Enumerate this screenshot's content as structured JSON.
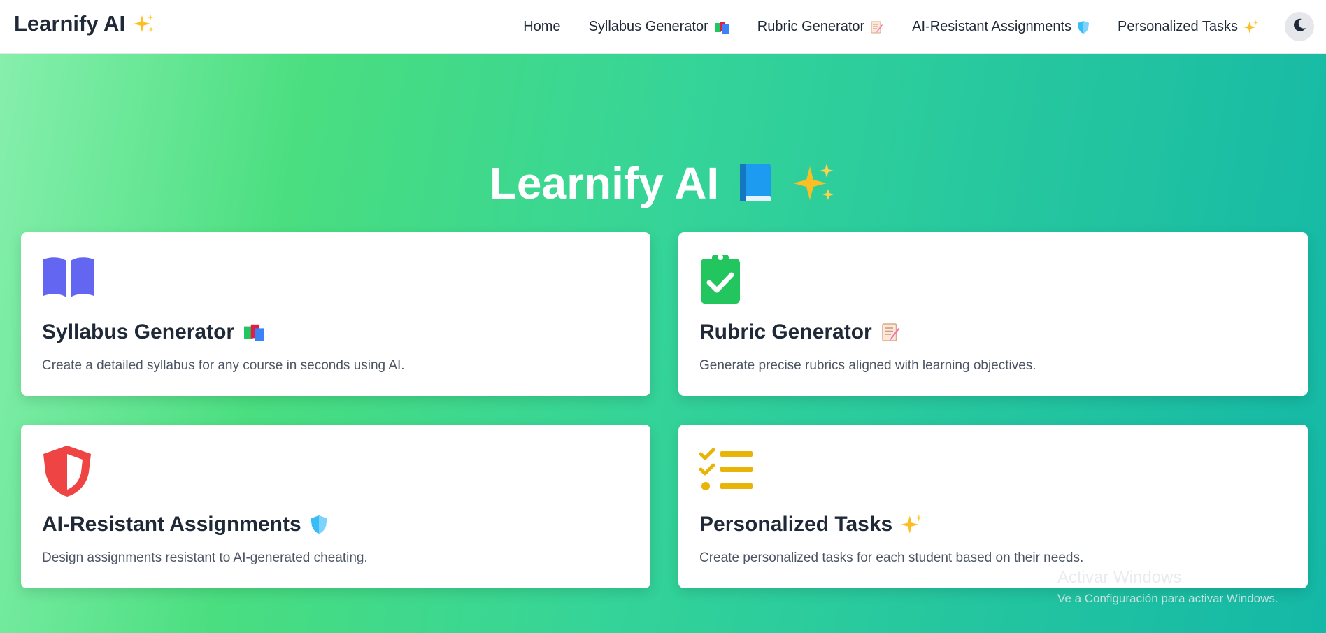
{
  "navbar": {
    "brand": "Learnify AI",
    "links": [
      {
        "label": "Home"
      },
      {
        "label": "Syllabus Generator"
      },
      {
        "label": "Rubric Generator"
      },
      {
        "label": "AI-Resistant Assignments"
      },
      {
        "label": "Personalized Tasks"
      }
    ],
    "theme_toggle_icon": "moon-icon"
  },
  "hero": {
    "title": "Learnify AI"
  },
  "cards": [
    {
      "title": "Syllabus Generator",
      "description": "Create a detailed syllabus for any course in seconds using AI.",
      "icon": "book-open-icon",
      "color": "#6366f1"
    },
    {
      "title": "Rubric Generator",
      "description": "Generate precise rubrics aligned with learning objectives.",
      "icon": "clipboard-check-icon",
      "color": "#22c55e"
    },
    {
      "title": "AI-Resistant Assignments",
      "description": "Design assignments resistant to AI-generated cheating.",
      "icon": "shield-icon",
      "color": "#ef4444"
    },
    {
      "title": "Personalized Tasks",
      "description": "Create personalized tasks for each student based on their needs.",
      "icon": "list-check-icon",
      "color": "#eab308"
    }
  ],
  "watermark": {
    "title": "Activar Windows",
    "subtitle": "Ve a Configuración para activar Windows."
  },
  "colors": {
    "gradient_start": "#86efac",
    "gradient_end": "#14b8a6"
  }
}
